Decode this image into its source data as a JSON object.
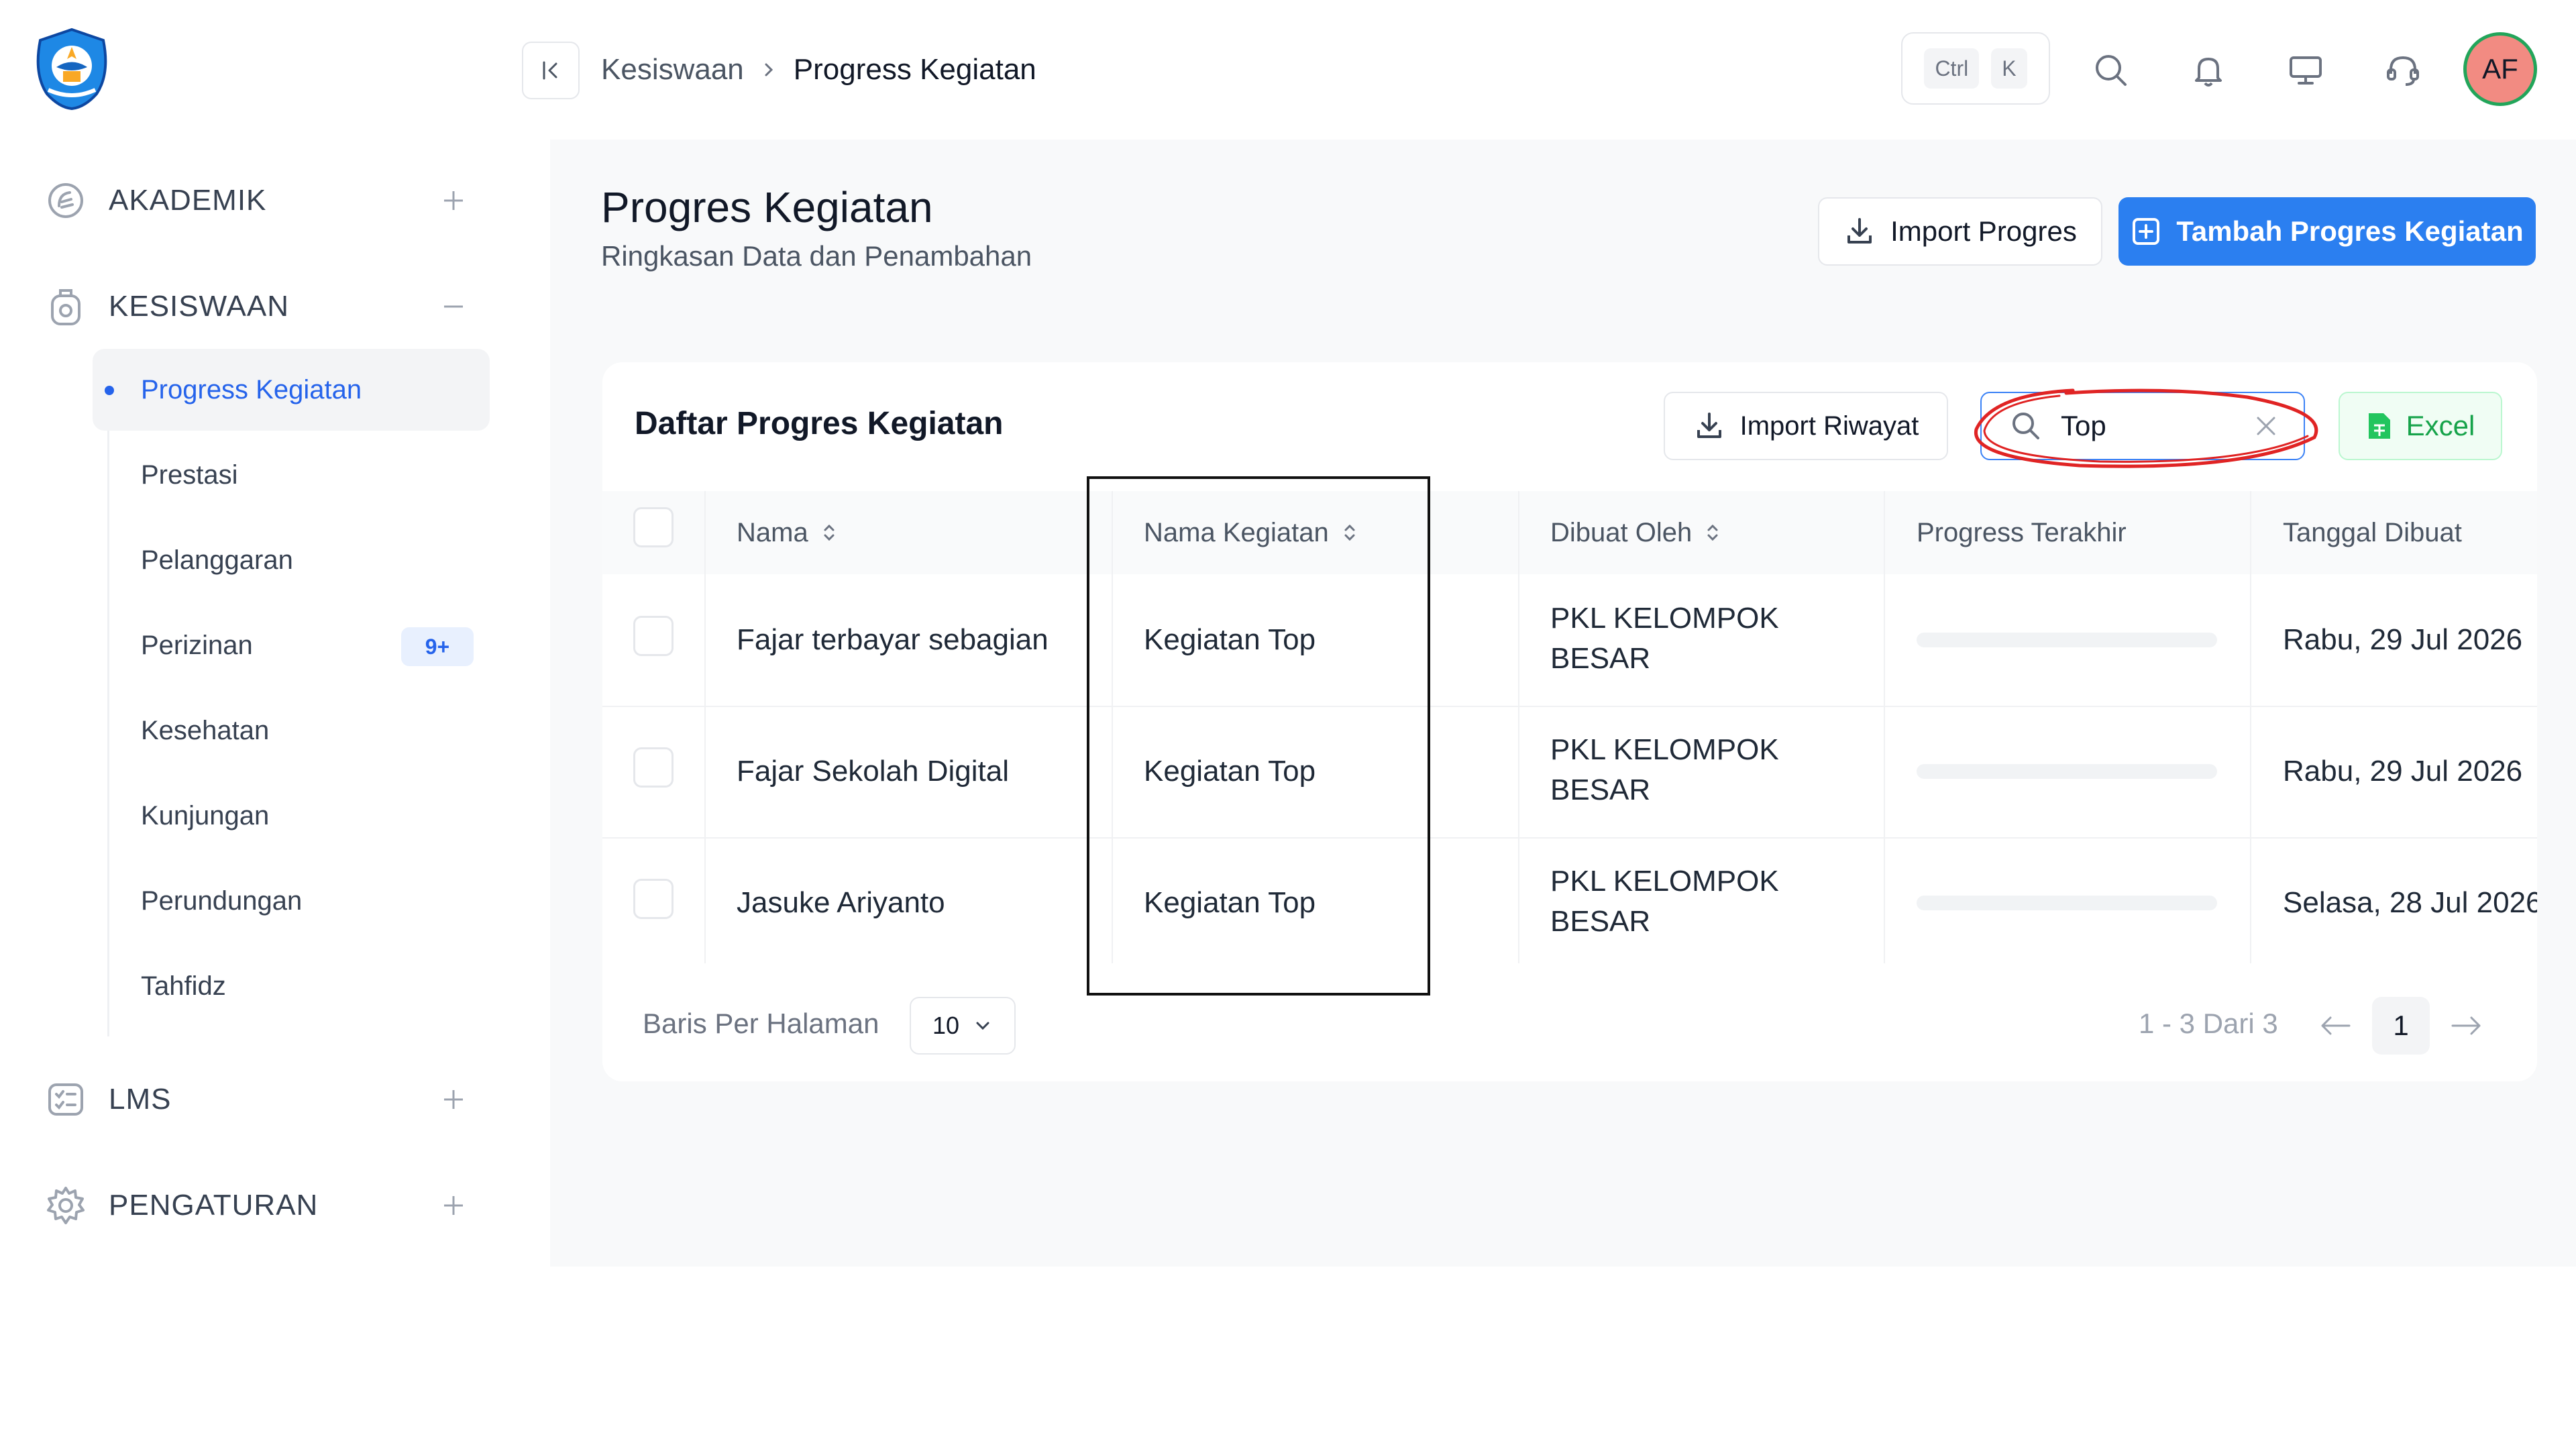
{
  "sidebar": {
    "groups": [
      {
        "label": "AKADEMIK",
        "icon": "academic-icon",
        "toggle": "plus-icon"
      },
      {
        "label": "KESISWAAN",
        "icon": "student-affairs-icon",
        "toggle": "minus-icon"
      },
      {
        "label": "LMS",
        "icon": "lms-icon",
        "toggle": "plus-icon"
      },
      {
        "label": "PENGATURAN",
        "icon": "settings-gear-icon",
        "toggle": "plus-icon"
      }
    ],
    "kesiswaan_items": [
      {
        "label": "Progress Kegiatan",
        "active": true
      },
      {
        "label": "Prestasi"
      },
      {
        "label": "Pelanggaran"
      },
      {
        "label": "Perizinan",
        "badge": "9+"
      },
      {
        "label": "Kesehatan"
      },
      {
        "label": "Kunjungan"
      },
      {
        "label": "Perundungan"
      },
      {
        "label": "Tahfidz"
      }
    ]
  },
  "topbar": {
    "breadcrumb": [
      "Kesiswaan",
      "Progress Kegiatan"
    ],
    "shortcut": {
      "key1": "Ctrl",
      "key2": "K"
    },
    "avatar_initials": "AF"
  },
  "page": {
    "title": "Progres Kegiatan",
    "subtitle": "Ringkasan Data dan Penambahan",
    "import_button": "Import Progres",
    "add_button": "Tambah Progres Kegiatan"
  },
  "card": {
    "title": "Daftar Progres Kegiatan",
    "import_history_button": "Import Riwayat",
    "search_value": "Top",
    "excel_button": "Excel"
  },
  "table": {
    "columns": [
      "Nama",
      "Nama Kegiatan",
      "Dibuat Oleh",
      "Progress Terakhir",
      "Tanggal Dibuat"
    ],
    "rows": [
      {
        "nama": "Fajar terbayar sebagian",
        "kegiatan": "Kegiatan Top",
        "dibuat_line1": "PKL KELOMPOK",
        "dibuat_line2": "BESAR",
        "progress": 0,
        "tanggal": "Rabu, 29 Jul 2026"
      },
      {
        "nama": "Fajar Sekolah Digital",
        "kegiatan": "Kegiatan Top",
        "dibuat_line1": "PKL KELOMPOK",
        "dibuat_line2": "BESAR",
        "progress": 0,
        "tanggal": "Rabu, 29 Jul 2026"
      },
      {
        "nama": "Jasuke Ariyanto",
        "kegiatan": "Kegiatan Top",
        "dibuat_line1": "PKL KELOMPOK",
        "dibuat_line2": "BESAR",
        "progress": 0,
        "tanggal": "Selasa, 28 Jul 2026"
      }
    ]
  },
  "pagination": {
    "rows_label": "Baris Per Halaman",
    "rows_value": "10",
    "range": "1 - 3 Dari 3",
    "current_page": "1"
  },
  "colors": {
    "primary": "#2b7ff0",
    "active_text": "#2563eb",
    "excel_green": "#16a34a",
    "annotation_red": "#e02424",
    "avatar_bg": "#f28b82",
    "avatar_ring": "#22a55a"
  }
}
